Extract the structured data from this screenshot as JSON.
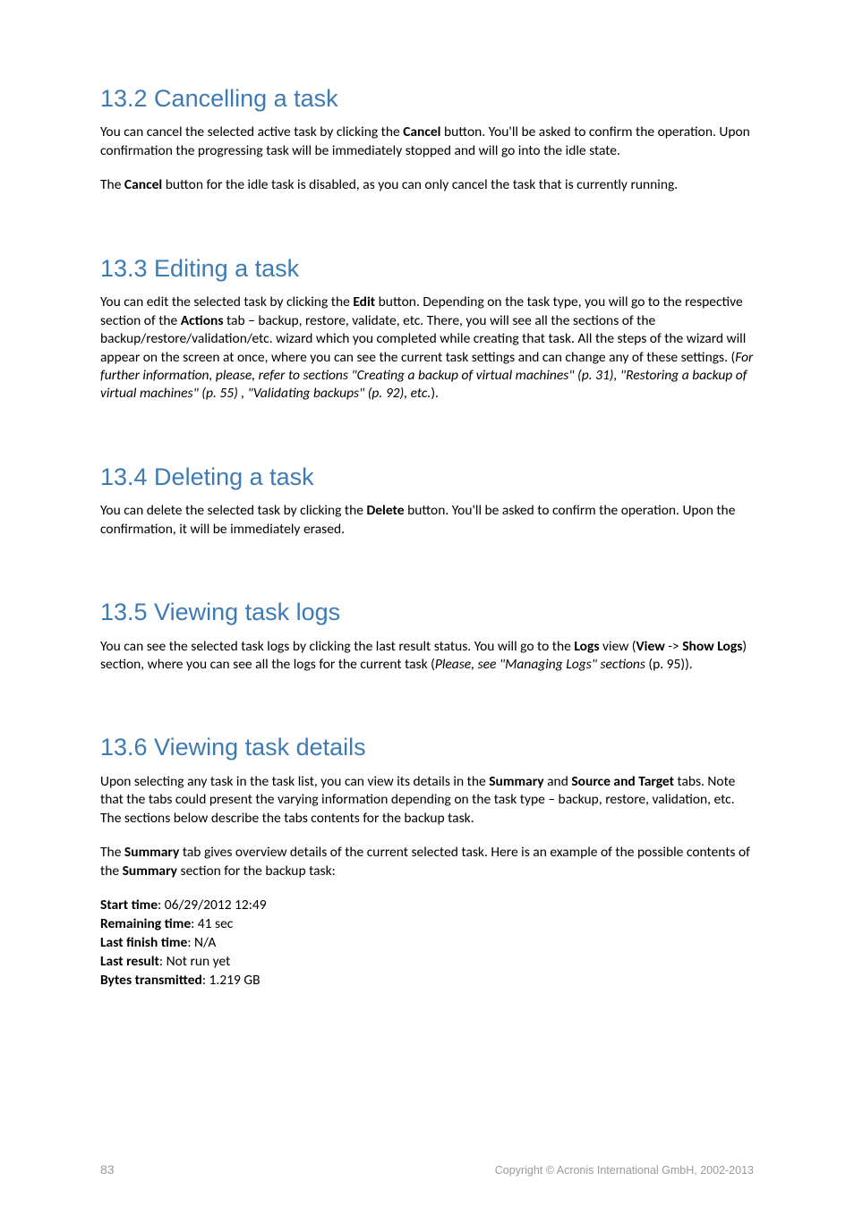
{
  "sections": {
    "s1": {
      "heading": "13.2  Cancelling a task",
      "p1_a": "You can cancel the selected active task by clicking the ",
      "p1_b": "Cancel",
      "p1_c": " button. You'll be asked to confirm the operation. Upon confirmation the progressing task will be immediately stopped and will go into the idle state.",
      "p2_a": "The ",
      "p2_b": "Cancel",
      "p2_c": " button for the idle task is disabled, as you can only cancel the task that is currently running."
    },
    "s2": {
      "heading": "13.3  Editing a task",
      "p1_a": "You can edit the selected task by clicking the ",
      "p1_b": "Edit",
      "p1_c": " button. Depending on the task type, you will go to the respective section of the ",
      "p1_d": "Actions",
      "p1_e": " tab – backup, restore, validate, etc. There, you will see all the sections of the backup/restore/validation/etc. wizard which you completed while creating that task. All the steps of the wizard will appear on the screen at once, where you can see the current task settings and can change any of these settings. (",
      "p1_f": "For further information, please, refer to sections \"Creating a backup of virtual machines\" (p. 31), \"Restoring a backup of virtual machines\" (p. 55) , \"Validating backups\" (p. 92), etc.",
      "p1_g": ")."
    },
    "s3": {
      "heading": "13.4  Deleting a task",
      "p1_a": "You can delete the selected task by clicking the ",
      "p1_b": "Delete",
      "p1_c": " button. You'll be asked to confirm the operation. Upon the confirmation, it will be immediately erased."
    },
    "s4": {
      "heading": "13.5  Viewing task logs",
      "p1_a": "You can see the selected task logs by clicking the last result status. You will go to the ",
      "p1_b": "Logs",
      "p1_c": " view (",
      "p1_d": "View",
      "p1_e": " -> ",
      "p1_f": "Show Logs",
      "p1_g": ") section, where you can see all the logs for the current task (",
      "p1_h": "Please, see \"Managing Logs\" sections",
      "p1_i": " (p. 95))."
    },
    "s5": {
      "heading": "13.6  Viewing task details",
      "p1_a": "Upon selecting any task in the task list, you can view its details in the ",
      "p1_b": "Summary",
      "p1_c": " and ",
      "p1_d": "Source and Target",
      "p1_e": " tabs. Note that the tabs could present the varying information depending on the task type – backup, restore, validation, etc. The sections below describe the tabs contents for the backup task.",
      "p2_a": "The ",
      "p2_b": "Summary",
      "p2_c": " tab gives overview details of the current selected task. Here is an example of the possible contents of the ",
      "p2_d": "Summary",
      "p2_e": " section for the backup task:",
      "details": {
        "start_label": "Start time",
        "start_value": ": 06/29/2012 12:49",
        "remain_label": "Remaining time",
        "remain_value": ": 41 sec",
        "finish_label": "Last finish time",
        "finish_value": ": N/A",
        "result_label": "Last result",
        "result_value": ": Not run yet",
        "bytes_label": "Bytes transmitted",
        "bytes_value": ": 1.219 GB"
      }
    }
  },
  "footer": {
    "page": "83",
    "copyright": "Copyright © Acronis International GmbH, 2002-2013"
  }
}
